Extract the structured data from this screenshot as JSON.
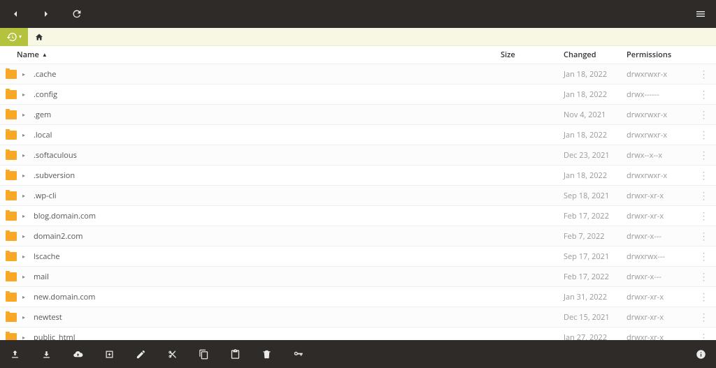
{
  "headers": {
    "name": "Name",
    "size": "Size",
    "changed": "Changed",
    "permissions": "Permissions"
  },
  "sort_indicator": "▲",
  "rows": [
    {
      "name": ".cache",
      "size": "",
      "changed": "Jan 18, 2022",
      "perm": "drwxrwxr-x"
    },
    {
      "name": ".config",
      "size": "",
      "changed": "Jan 18, 2022",
      "perm": "drwx------"
    },
    {
      "name": ".gem",
      "size": "",
      "changed": "Nov 4, 2021",
      "perm": "drwxrwxr-x"
    },
    {
      "name": ".local",
      "size": "",
      "changed": "Jan 18, 2022",
      "perm": "drwxrwxr-x"
    },
    {
      "name": ".softaculous",
      "size": "",
      "changed": "Dec 23, 2021",
      "perm": "drwx--x--x"
    },
    {
      "name": ".subversion",
      "size": "",
      "changed": "Jan 18, 2022",
      "perm": "drwxrwxr-x"
    },
    {
      "name": ".wp-cli",
      "size": "",
      "changed": "Sep 18, 2021",
      "perm": "drwxr-xr-x"
    },
    {
      "name": "blog.domain.com",
      "size": "",
      "changed": "Feb 17, 2022",
      "perm": "drwxr-xr-x"
    },
    {
      "name": "domain2.com",
      "size": "",
      "changed": "Feb 7, 2022",
      "perm": "drwxr-x---"
    },
    {
      "name": "lscache",
      "size": "",
      "changed": "Sep 17, 2021",
      "perm": "drwxrwx---"
    },
    {
      "name": "mail",
      "size": "",
      "changed": "Feb 17, 2022",
      "perm": "drwxr-x---"
    },
    {
      "name": "new.domain.com",
      "size": "",
      "changed": "Jan 31, 2022",
      "perm": "drwxr-xr-x"
    },
    {
      "name": "newtest",
      "size": "",
      "changed": "Dec 15, 2021",
      "perm": "drwxr-xr-x"
    },
    {
      "name": "public_html",
      "size": "",
      "changed": "Jan 27, 2022",
      "perm": "drwxr-xr-x"
    }
  ]
}
